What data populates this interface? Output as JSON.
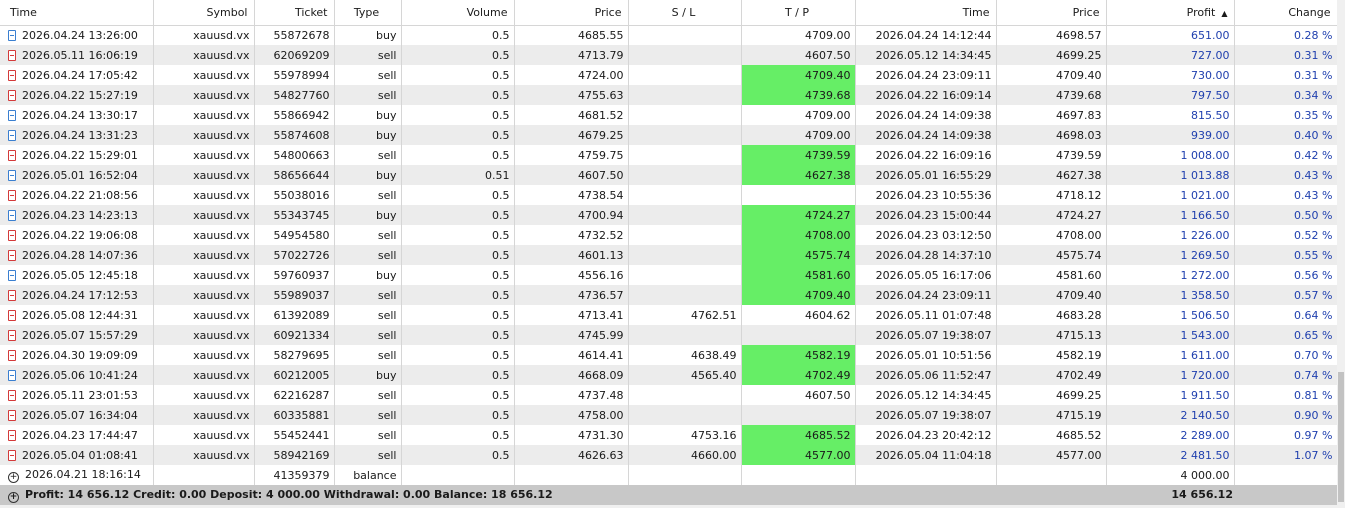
{
  "columns": {
    "time": "Time",
    "symbol": "Symbol",
    "ticket": "Ticket",
    "type": "Type",
    "volume": "Volume",
    "price": "Price",
    "sl": "S / L",
    "tp": "T / P",
    "close_time": "Time",
    "close_price": "Price",
    "profit": "Profit",
    "change": "Change"
  },
  "sort_indicator": "▲",
  "rows": [
    {
      "time": "2026.04.24 13:26:00",
      "symbol": "xauusd.vx",
      "ticket": "55872678",
      "type": "buy",
      "volume": "0.5",
      "price": "4685.55",
      "sl": "",
      "tp": "4709.00",
      "tp_hit": false,
      "close_time": "2026.04.24 14:12:44",
      "close_price": "4698.57",
      "profit": "651.00",
      "change": "0.28 %"
    },
    {
      "time": "2026.05.11 16:06:19",
      "symbol": "xauusd.vx",
      "ticket": "62069209",
      "type": "sell",
      "volume": "0.5",
      "price": "4713.79",
      "sl": "",
      "tp": "4607.50",
      "tp_hit": false,
      "close_time": "2026.05.12 14:34:45",
      "close_price": "4699.25",
      "profit": "727.00",
      "change": "0.31 %"
    },
    {
      "time": "2026.04.24 17:05:42",
      "symbol": "xauusd.vx",
      "ticket": "55978994",
      "type": "sell",
      "volume": "0.5",
      "price": "4724.00",
      "sl": "",
      "tp": "4709.40",
      "tp_hit": true,
      "close_time": "2026.04.24 23:09:11",
      "close_price": "4709.40",
      "profit": "730.00",
      "change": "0.31 %"
    },
    {
      "time": "2026.04.22 15:27:19",
      "symbol": "xauusd.vx",
      "ticket": "54827760",
      "type": "sell",
      "volume": "0.5",
      "price": "4755.63",
      "sl": "",
      "tp": "4739.68",
      "tp_hit": true,
      "close_time": "2026.04.22 16:09:14",
      "close_price": "4739.68",
      "profit": "797.50",
      "change": "0.34 %"
    },
    {
      "time": "2026.04.24 13:30:17",
      "symbol": "xauusd.vx",
      "ticket": "55866942",
      "type": "buy",
      "volume": "0.5",
      "price": "4681.52",
      "sl": "",
      "tp": "4709.00",
      "tp_hit": false,
      "close_time": "2026.04.24 14:09:38",
      "close_price": "4697.83",
      "profit": "815.50",
      "change": "0.35 %"
    },
    {
      "time": "2026.04.24 13:31:23",
      "symbol": "xauusd.vx",
      "ticket": "55874608",
      "type": "buy",
      "volume": "0.5",
      "price": "4679.25",
      "sl": "",
      "tp": "4709.00",
      "tp_hit": false,
      "close_time": "2026.04.24 14:09:38",
      "close_price": "4698.03",
      "profit": "939.00",
      "change": "0.40 %"
    },
    {
      "time": "2026.04.22 15:29:01",
      "symbol": "xauusd.vx",
      "ticket": "54800663",
      "type": "sell",
      "volume": "0.5",
      "price": "4759.75",
      "sl": "",
      "tp": "4739.59",
      "tp_hit": true,
      "close_time": "2026.04.22 16:09:16",
      "close_price": "4739.59",
      "profit": "1 008.00",
      "change": "0.42 %"
    },
    {
      "time": "2026.05.01 16:52:04",
      "symbol": "xauusd.vx",
      "ticket": "58656644",
      "type": "buy",
      "volume": "0.51",
      "price": "4607.50",
      "sl": "",
      "tp": "4627.38",
      "tp_hit": true,
      "close_time": "2026.05.01 16:55:29",
      "close_price": "4627.38",
      "profit": "1 013.88",
      "change": "0.43 %"
    },
    {
      "time": "2026.04.22 21:08:56",
      "symbol": "xauusd.vx",
      "ticket": "55038016",
      "type": "sell",
      "volume": "0.5",
      "price": "4738.54",
      "sl": "",
      "tp": "",
      "tp_hit": false,
      "close_time": "2026.04.23 10:55:36",
      "close_price": "4718.12",
      "profit": "1 021.00",
      "change": "0.43 %"
    },
    {
      "time": "2026.04.23 14:23:13",
      "symbol": "xauusd.vx",
      "ticket": "55343745",
      "type": "buy",
      "volume": "0.5",
      "price": "4700.94",
      "sl": "",
      "tp": "4724.27",
      "tp_hit": true,
      "close_time": "2026.04.23 15:00:44",
      "close_price": "4724.27",
      "profit": "1 166.50",
      "change": "0.50 %"
    },
    {
      "time": "2026.04.22 19:06:08",
      "symbol": "xauusd.vx",
      "ticket": "54954580",
      "type": "sell",
      "volume": "0.5",
      "price": "4732.52",
      "sl": "",
      "tp": "4708.00",
      "tp_hit": true,
      "close_time": "2026.04.23 03:12:50",
      "close_price": "4708.00",
      "profit": "1 226.00",
      "change": "0.52 %"
    },
    {
      "time": "2026.04.28 14:07:36",
      "symbol": "xauusd.vx",
      "ticket": "57022726",
      "type": "sell",
      "volume": "0.5",
      "price": "4601.13",
      "sl": "",
      "tp": "4575.74",
      "tp_hit": true,
      "close_time": "2026.04.28 14:37:10",
      "close_price": "4575.74",
      "profit": "1 269.50",
      "change": "0.55 %"
    },
    {
      "time": "2026.05.05 12:45:18",
      "symbol": "xauusd.vx",
      "ticket": "59760937",
      "type": "buy",
      "volume": "0.5",
      "price": "4556.16",
      "sl": "",
      "tp": "4581.60",
      "tp_hit": true,
      "close_time": "2026.05.05 16:17:06",
      "close_price": "4581.60",
      "profit": "1 272.00",
      "change": "0.56 %"
    },
    {
      "time": "2026.04.24 17:12:53",
      "symbol": "xauusd.vx",
      "ticket": "55989037",
      "type": "sell",
      "volume": "0.5",
      "price": "4736.57",
      "sl": "",
      "tp": "4709.40",
      "tp_hit": true,
      "close_time": "2026.04.24 23:09:11",
      "close_price": "4709.40",
      "profit": "1 358.50",
      "change": "0.57 %"
    },
    {
      "time": "2026.05.08 12:44:31",
      "symbol": "xauusd.vx",
      "ticket": "61392089",
      "type": "sell",
      "volume": "0.5",
      "price": "4713.41",
      "sl": "4762.51",
      "tp": "4604.62",
      "tp_hit": false,
      "close_time": "2026.05.11 01:07:48",
      "close_price": "4683.28",
      "profit": "1 506.50",
      "change": "0.64 %"
    },
    {
      "time": "2026.05.07 15:57:29",
      "symbol": "xauusd.vx",
      "ticket": "60921334",
      "type": "sell",
      "volume": "0.5",
      "price": "4745.99",
      "sl": "",
      "tp": "",
      "tp_hit": false,
      "close_time": "2026.05.07 19:38:07",
      "close_price": "4715.13",
      "profit": "1 543.00",
      "change": "0.65 %"
    },
    {
      "time": "2026.04.30 19:09:09",
      "symbol": "xauusd.vx",
      "ticket": "58279695",
      "type": "sell",
      "volume": "0.5",
      "price": "4614.41",
      "sl": "4638.49",
      "tp": "4582.19",
      "tp_hit": true,
      "close_time": "2026.05.01 10:51:56",
      "close_price": "4582.19",
      "profit": "1 611.00",
      "change": "0.70 %"
    },
    {
      "time": "2026.05.06 10:41:24",
      "symbol": "xauusd.vx",
      "ticket": "60212005",
      "type": "buy",
      "volume": "0.5",
      "price": "4668.09",
      "sl": "4565.40",
      "tp": "4702.49",
      "tp_hit": true,
      "close_time": "2026.05.06 11:52:47",
      "close_price": "4702.49",
      "profit": "1 720.00",
      "change": "0.74 %"
    },
    {
      "time": "2026.05.11 23:01:53",
      "symbol": "xauusd.vx",
      "ticket": "62216287",
      "type": "sell",
      "volume": "0.5",
      "price": "4737.48",
      "sl": "",
      "tp": "4607.50",
      "tp_hit": false,
      "close_time": "2026.05.12 14:34:45",
      "close_price": "4699.25",
      "profit": "1 911.50",
      "change": "0.81 %"
    },
    {
      "time": "2026.05.07 16:34:04",
      "symbol": "xauusd.vx",
      "ticket": "60335881",
      "type": "sell",
      "volume": "0.5",
      "price": "4758.00",
      "sl": "",
      "tp": "",
      "tp_hit": false,
      "close_time": "2026.05.07 19:38:07",
      "close_price": "4715.19",
      "profit": "2 140.50",
      "change": "0.90 %"
    },
    {
      "time": "2026.04.23 17:44:47",
      "symbol": "xauusd.vx",
      "ticket": "55452441",
      "type": "sell",
      "volume": "0.5",
      "price": "4731.30",
      "sl": "4753.16",
      "tp": "4685.52",
      "tp_hit": true,
      "close_time": "2026.04.23 20:42:12",
      "close_price": "4685.52",
      "profit": "2 289.00",
      "change": "0.97 %"
    },
    {
      "time": "2026.05.04 01:08:41",
      "symbol": "xauusd.vx",
      "ticket": "58942169",
      "type": "sell",
      "volume": "0.5",
      "price": "4626.63",
      "sl": "4660.00",
      "tp": "4577.00",
      "tp_hit": true,
      "close_time": "2026.05.04 11:04:18",
      "close_price": "4577.00",
      "profit": "2 481.50",
      "change": "1.07 %"
    }
  ],
  "balance_row": {
    "time": "2026.04.21 18:16:14",
    "ticket": "41359379",
    "type": "balance",
    "profit": "4 000.00"
  },
  "summary": {
    "text": "Profit: 14 656.12  Credit: 0.00  Deposit: 4 000.00  Withdrawal: 0.00  Balance: 18 656.12",
    "total": "14 656.12"
  },
  "colors": {
    "tp_hit": "#66ee66",
    "profit_text": "#1f3fae",
    "buy_icon": "#3a7fd0",
    "sell_icon": "#d43a3a",
    "summary_bg": "#c8c8c8",
    "row_alt": "#ececec"
  },
  "icons": {
    "buy": "buy-order-icon",
    "sell": "sell-order-icon",
    "balance": "expand-icon",
    "summary": "expand-icon"
  }
}
